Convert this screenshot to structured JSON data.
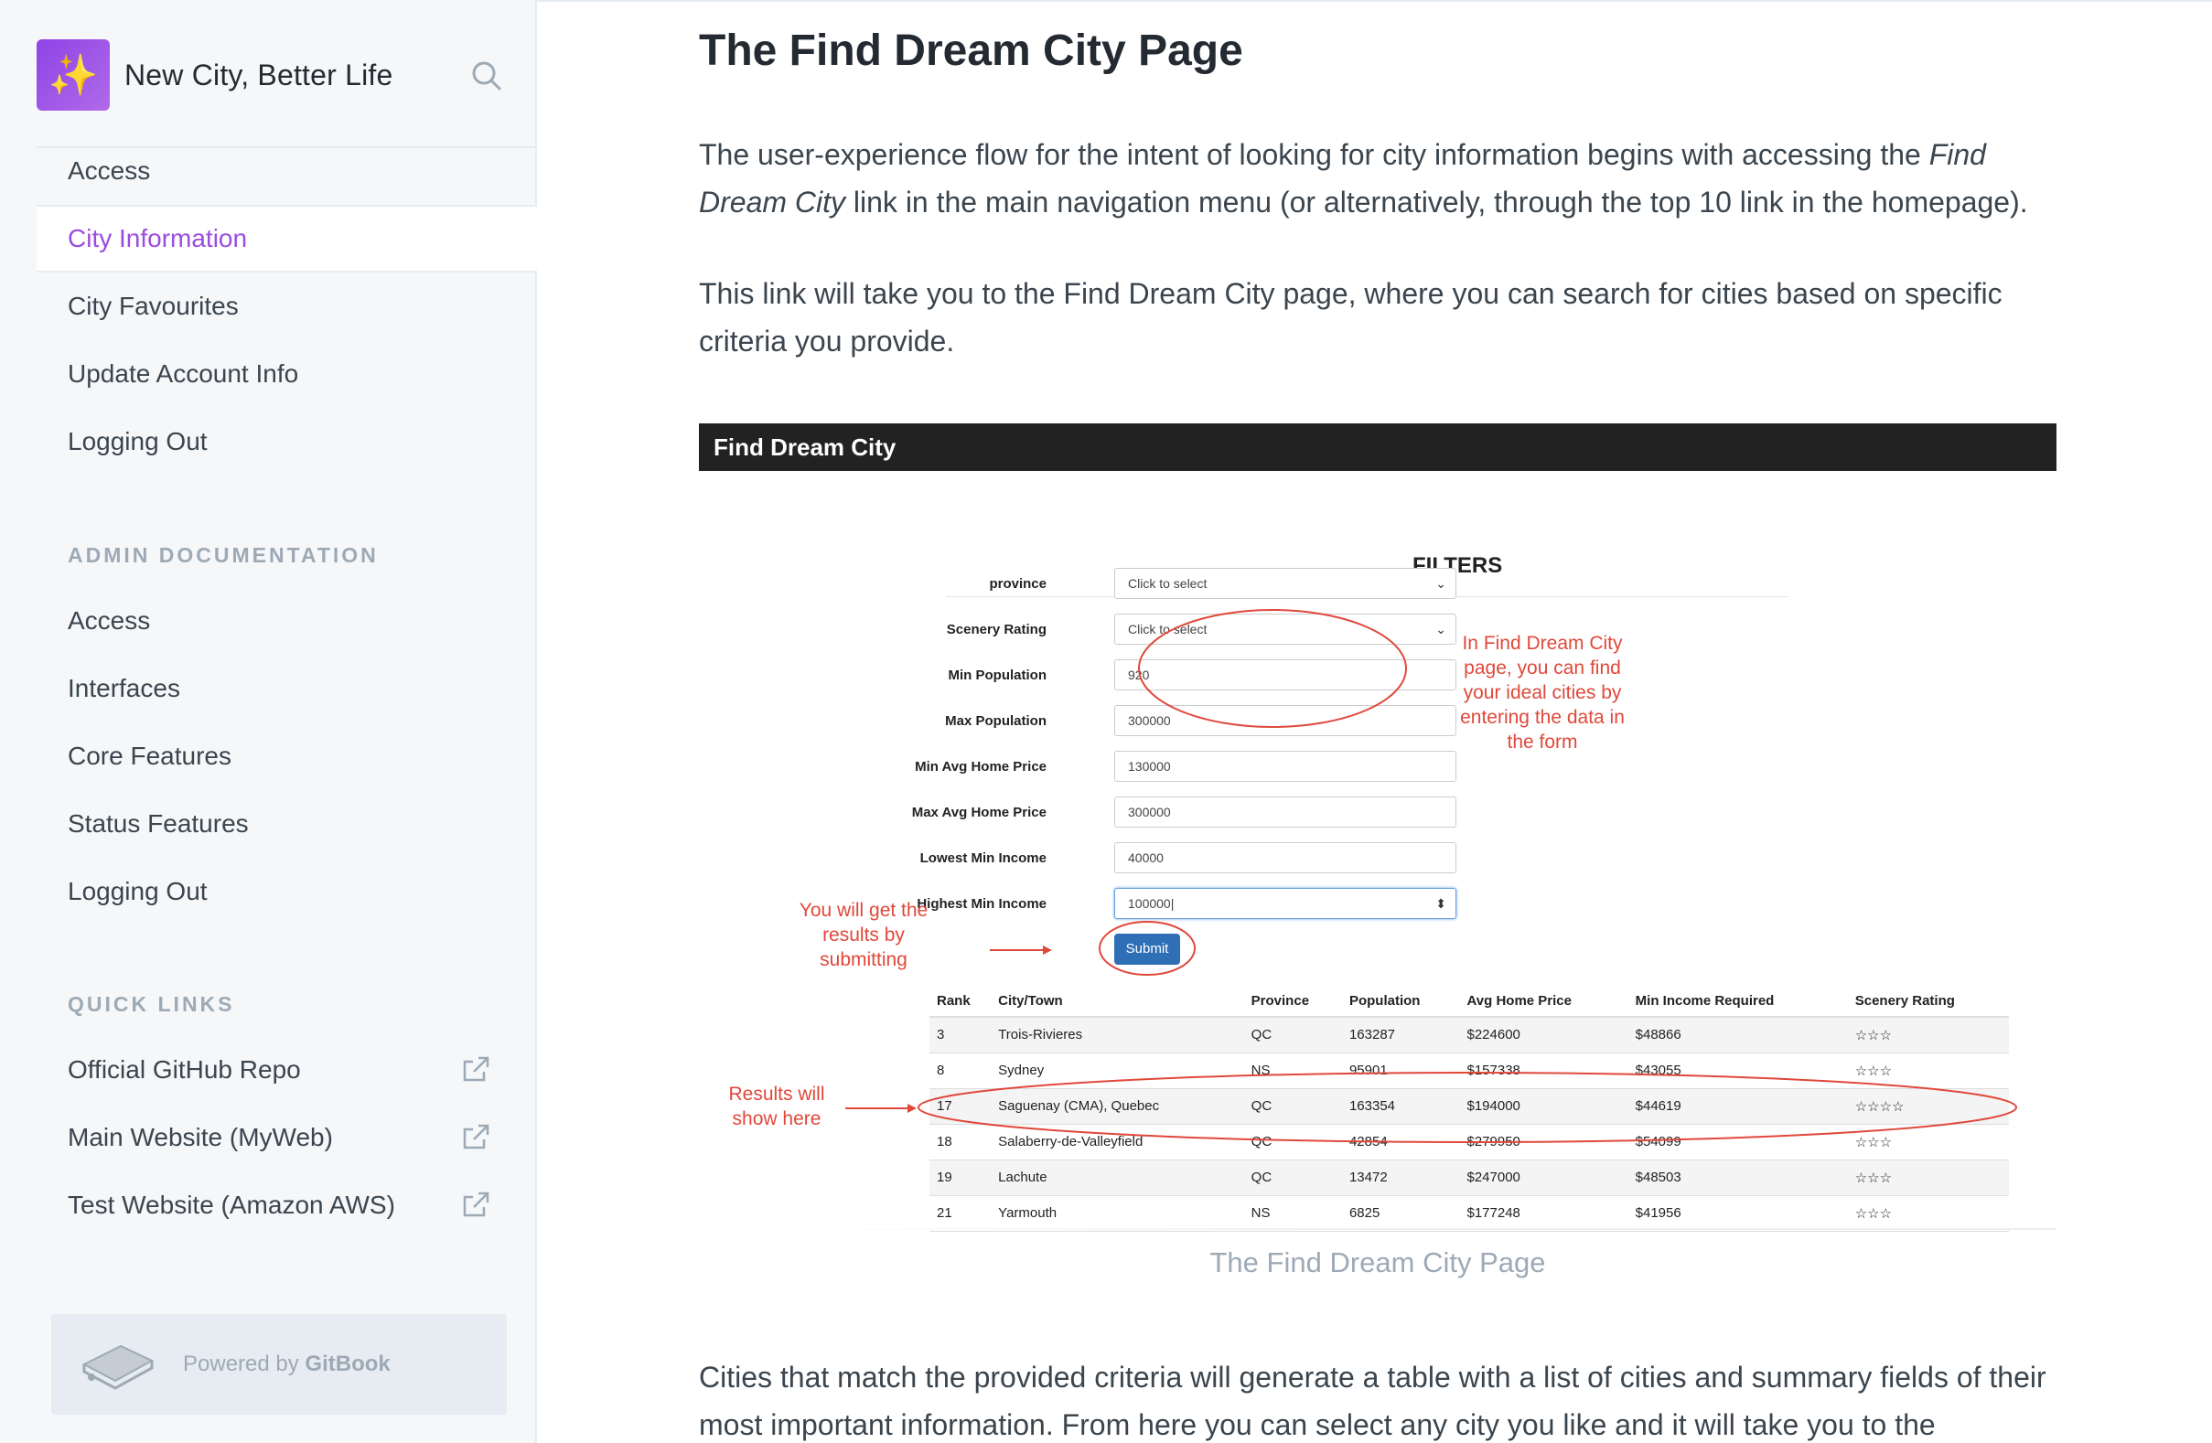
{
  "sidebar": {
    "brand_title": "New City, Better Life",
    "user_items": [
      {
        "label": "Access",
        "active": false
      },
      {
        "label": "City Information",
        "active": true
      },
      {
        "label": "City Favourites",
        "active": false
      },
      {
        "label": "Update Account Info",
        "active": false
      },
      {
        "label": "Logging Out",
        "active": false
      }
    ],
    "admin_section_title": "ADMIN DOCUMENTATION",
    "admin_items": [
      {
        "label": "Access"
      },
      {
        "label": "Interfaces"
      },
      {
        "label": "Core Features"
      },
      {
        "label": "Status Features"
      },
      {
        "label": "Logging Out"
      }
    ],
    "quick_links_title": "QUICK LINKS",
    "quick_links": [
      {
        "label": "Official GitHub Repo",
        "icon": "external-link-icon"
      },
      {
        "label": "Main Website (MyWeb)",
        "icon": "external-link-icon"
      },
      {
        "label": "Test Website (Amazon AWS)",
        "icon": "external-link-icon"
      }
    ],
    "powered_prefix": "Powered by ",
    "powered_brand": "GitBook"
  },
  "main": {
    "title": "The Find Dream City Page",
    "para1_before": "The user-experience flow for the intent of looking for city information begins with accessing the ",
    "para1_em": "Find Dream City",
    "para1_after": " link in the main navigation menu (or alternatively, through the top 10 link in the homepage).",
    "para2": "This link will take you to the Find Dream City page, where you can search for cities based on specific criteria you provide.",
    "para3": "Cities that match the provided criteria will generate a table with a list of cities and summary fields of their most important information. From here you can select any city you like and it will take you to the"
  },
  "figure": {
    "header": "Find Dream City",
    "filters_title": "FILTERS",
    "form": [
      {
        "label": "province",
        "value": "Click to select",
        "type": "select"
      },
      {
        "label": "Scenery Rating",
        "value": "Click to select",
        "type": "select"
      },
      {
        "label": "Min Population",
        "value": "920",
        "type": "text"
      },
      {
        "label": "Max Population",
        "value": "300000",
        "type": "text"
      },
      {
        "label": "Min Avg Home Price",
        "value": "130000",
        "type": "text"
      },
      {
        "label": "Max Avg Home Price",
        "value": "300000",
        "type": "text"
      },
      {
        "label": "Lowest Min Income",
        "value": "40000",
        "type": "text"
      },
      {
        "label": "Highest Min Income",
        "value": "100000|",
        "type": "number"
      }
    ],
    "submit_label": "Submit",
    "annotation_form": "In Find Dream City page, you can find your ideal cities by entering the data in the form",
    "annotation_submit": "You will get the results by submitting",
    "annotation_results": "Results will show here",
    "table_headers": [
      "Rank",
      "City/Town",
      "Province",
      "Population",
      "Avg Home Price",
      "Min Income Required",
      "Scenery Rating"
    ],
    "table_rows": [
      [
        "3",
        "Trois-Rivieres",
        "QC",
        "163287",
        "$224600",
        "$48866",
        "☆☆☆"
      ],
      [
        "8",
        "Sydney",
        "NS",
        "95901",
        "$157338",
        "$43055",
        "☆☆☆"
      ],
      [
        "17",
        "Saguenay (CMA), Quebec",
        "QC",
        "163354",
        "$194000",
        "$44619",
        "☆☆☆☆"
      ],
      [
        "18",
        "Salaberry-de-Valleyfield",
        "QC",
        "42854",
        "$279950",
        "$54099",
        "☆☆☆"
      ],
      [
        "19",
        "Lachute",
        "QC",
        "13472",
        "$247000",
        "$48503",
        "☆☆☆"
      ],
      [
        "21",
        "Yarmouth",
        "NS",
        "6825",
        "$177248",
        "$41956",
        "☆☆☆"
      ]
    ],
    "caption": "The Find Dream City Page",
    "annotation_color": "#e0483a"
  },
  "colors": {
    "accent": "#9b4ce0",
    "sidebar_bg": "#f5f7f9",
    "text": "#3b454e"
  }
}
